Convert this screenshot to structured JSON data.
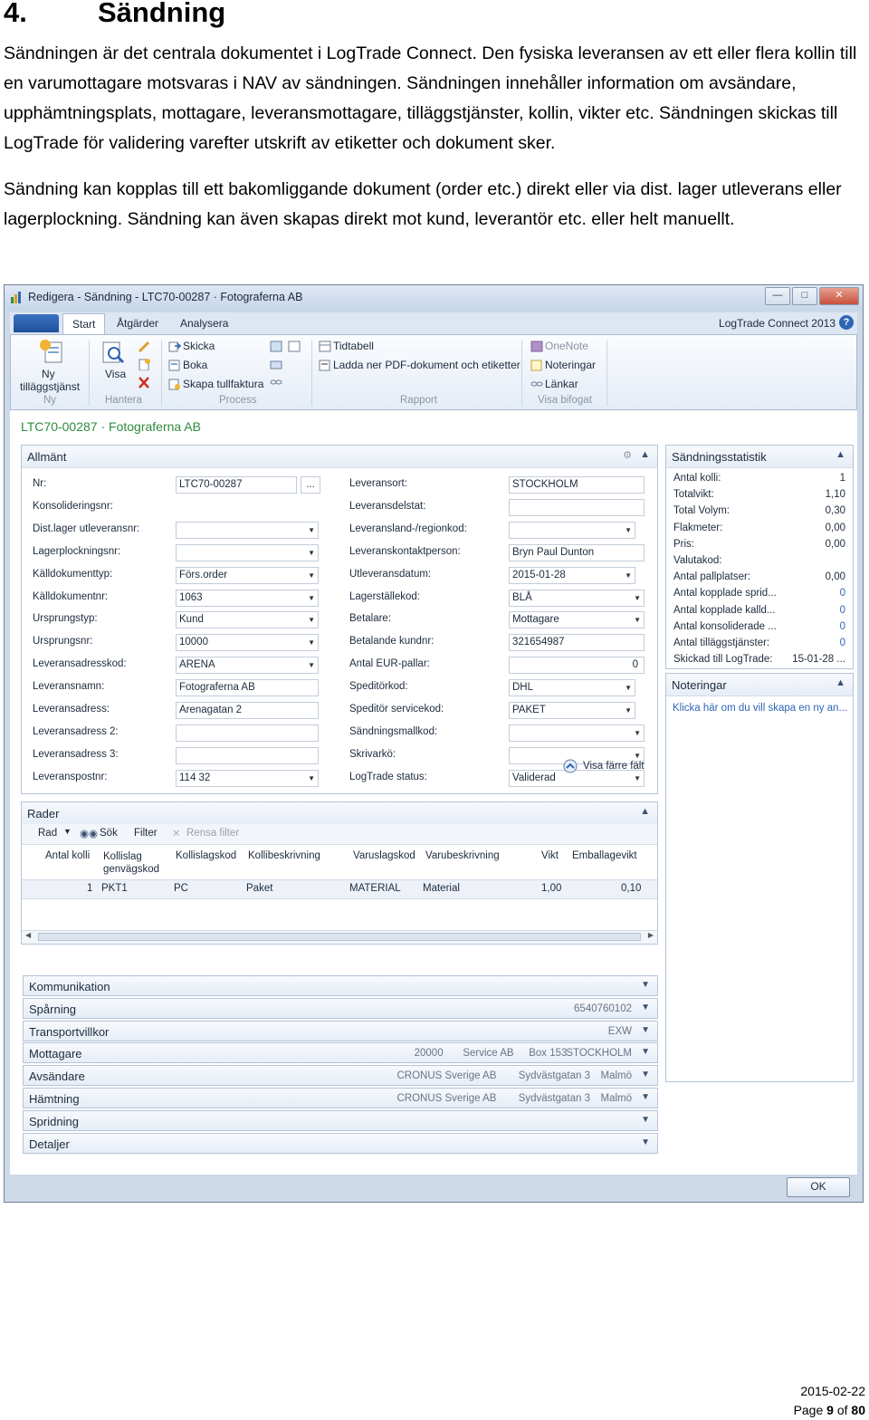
{
  "document": {
    "heading_number": "4.",
    "heading_title": "Sändning",
    "paragraph1": "Sändningen är det centrala dokumentet i LogTrade Connect. Den fysiska leveransen av ett eller flera kollin till en varumottagare motsvaras i NAV av sändningen. Sändningen innehåller information om avsändare, upphämtningsplats, mottagare, leveransmottagare, tilläggstjänster, kollin, vikter etc. Sändningen skickas till LogTrade för validering varefter utskrift av etiketter och dokument sker.",
    "paragraph2": "Sändning kan kopplas till ett bakomliggande dokument (order etc.) direkt eller via dist. lager utleverans eller lagerplockning. Sändning kan även skapas direkt mot kund, leverantör etc. eller helt manuellt.",
    "footer_date": "2015-02-22",
    "footer_page_prefix": "Page ",
    "footer_page_current": "9",
    "footer_page_mid": " of ",
    "footer_page_total": "80"
  },
  "window": {
    "title": "Redigera - Sändning - LTC70-00287 · Fotograferna AB",
    "brand": "LogTrade Connect 2013",
    "tabs": [
      "Start",
      "Åtgärder",
      "Analysera"
    ],
    "ribbon": {
      "ny_label": "Ny tilläggstjänst",
      "ny_line1": "Ny",
      "ny_line2": "tilläggstjänst",
      "visa": "Visa",
      "skicka": "Skicka",
      "boka": "Boka",
      "skapa_tullfaktura": "Skapa tullfaktura",
      "tidtabell": "Tidtabell",
      "ladda_ner": "Ladda ner PDF-dokument och etiketter",
      "onenote": "OneNote",
      "noteringar": "Noteringar",
      "lankar": "Länkar",
      "groups": {
        "ny": "Ny",
        "hantera": "Hantera",
        "process": "Process",
        "rapport": "Rapport",
        "visa_bifogat": "Visa bifogat"
      }
    },
    "page_title": "LTC70-00287 · Fotograferna AB",
    "allmant": {
      "title": "Allmänt",
      "left_fields": [
        {
          "label": "Nr:",
          "value": "LTC70-00287",
          "type": "text"
        },
        {
          "label": "Konsolideringsnr:",
          "value": "",
          "type": "none"
        },
        {
          "label": "Dist.lager utleveransnr:",
          "value": "",
          "type": "dropdown"
        },
        {
          "label": "Lagerplockningsnr:",
          "value": "",
          "type": "dropdown"
        },
        {
          "label": "Källdokumenttyp:",
          "value": "Förs.order",
          "type": "dropdown"
        },
        {
          "label": "Källdokumentnr:",
          "value": "1063",
          "type": "dropdown"
        },
        {
          "label": "Ursprungstyp:",
          "value": "Kund",
          "type": "dropdown"
        },
        {
          "label": "Ursprungsnr:",
          "value": "10000",
          "type": "dropdown"
        },
        {
          "label": "Leveransadresskod:",
          "value": "ARENA",
          "type": "dropdown"
        },
        {
          "label": "Leveransnamn:",
          "value": "Fotograferna AB",
          "type": "text"
        },
        {
          "label": "Leveransadress:",
          "value": "Arenagatan 2",
          "type": "text"
        },
        {
          "label": "Leveransadress 2:",
          "value": "",
          "type": "text"
        },
        {
          "label": "Leveransadress 3:",
          "value": "",
          "type": "text"
        },
        {
          "label": "Leveranspostnr:",
          "value": "114 32",
          "type": "dropdown"
        }
      ],
      "right_fields": [
        {
          "label": "Leveransort:",
          "value": "STOCKHOLM",
          "type": "text"
        },
        {
          "label": "Leveransdelstat:",
          "value": "",
          "type": "text"
        },
        {
          "label": "Leveransland-/regionkod:",
          "value": "",
          "type": "dropdown-short"
        },
        {
          "label": "Leveranskontaktperson:",
          "value": "Bryn Paul Dunton",
          "type": "text"
        },
        {
          "label": "Utleveransdatum:",
          "value": "2015-01-28",
          "type": "dropdown-short"
        },
        {
          "label": "Lagerställekod:",
          "value": "BLÅ",
          "type": "dropdown"
        },
        {
          "label": "Betalare:",
          "value": "Mottagare",
          "type": "dropdown"
        },
        {
          "label": "Betalande kundnr:",
          "value": "321654987",
          "type": "text"
        },
        {
          "label": "Antal EUR-pallar:",
          "value": "0",
          "type": "num"
        },
        {
          "label": "Speditörkod:",
          "value": "DHL",
          "type": "dropdown-short"
        },
        {
          "label": "Speditör servicekod:",
          "value": "PAKET",
          "type": "dropdown-short"
        },
        {
          "label": "Sändningsmallkod:",
          "value": "",
          "type": "dropdown"
        },
        {
          "label": "Skrivarkö:",
          "value": "",
          "type": "dropdown"
        },
        {
          "label": "LogTrade status:",
          "value": "Validerad",
          "type": "dropdown"
        }
      ],
      "fewer_fields": "Visa färre fält"
    },
    "stats": {
      "title": "Sändningsstatistik",
      "rows": [
        {
          "label": "Antal kolli:",
          "value": "1",
          "blue": false
        },
        {
          "label": "Totalvikt:",
          "value": "1,10",
          "blue": false
        },
        {
          "label": "Total Volym:",
          "value": "0,30",
          "blue": false
        },
        {
          "label": "Flakmeter:",
          "value": "0,00",
          "blue": false
        },
        {
          "label": "Pris:",
          "value": "0,00",
          "blue": false
        },
        {
          "label": "Valutakod:",
          "value": "",
          "blue": false
        },
        {
          "label": "Antal pallplatser:",
          "value": "0,00",
          "blue": false
        },
        {
          "label": "Antal kopplade sprid...",
          "value": "0",
          "blue": true
        },
        {
          "label": "Antal kopplade kalld...",
          "value": "0",
          "blue": true
        },
        {
          "label": "Antal konsoliderade ...",
          "value": "0",
          "blue": true
        },
        {
          "label": "Antal tilläggstjänster:",
          "value": "0",
          "blue": true
        },
        {
          "label": "Skickad till LogTrade:",
          "value": "15-01-28 ...",
          "blue": false
        }
      ]
    },
    "notes": {
      "title": "Noteringar",
      "link": "Klicka här om du vill skapa en ny an..."
    },
    "rader": {
      "title": "Rader",
      "toolbar": {
        "rad": "Rad",
        "sok": "Sök",
        "filter": "Filter",
        "rensa": "Rensa filter"
      },
      "columns": [
        "Antal kolli",
        "Kollislag genvägskod",
        "Kollislagskod",
        "Kollibeskrivning",
        "Varuslagskod",
        "Varubeskrivning",
        "Vikt",
        "Emballagevikt"
      ],
      "col_kollislag_1": "Kollislag",
      "col_kollislag_2": "genvägskod",
      "rows": [
        {
          "antal": "1",
          "genvag": "PKT1",
          "kollislag": "PC",
          "kollibeskr": "Paket",
          "varuslag": "MATERIAL",
          "varubeskr": "Material",
          "vikt": "1,00",
          "emballage": "0,10"
        }
      ]
    },
    "fasttabs": [
      {
        "title": "Kommunikation",
        "values": []
      },
      {
        "title": "Spårning",
        "values": [
          "6540760102"
        ]
      },
      {
        "title": "Transportvillkor",
        "values": [
          "EXW"
        ]
      },
      {
        "title": "Mottagare",
        "values": [
          "20000",
          "Service AB",
          "Box 153",
          "STOCKHOLM"
        ]
      },
      {
        "title": "Avsändare",
        "values": [
          "CRONUS Sverige AB",
          "Sydvästgatan 3",
          "Malmö"
        ]
      },
      {
        "title": "Hämtning",
        "values": [
          "CRONUS Sverige AB",
          "Sydvästgatan 3",
          "Malmö"
        ]
      },
      {
        "title": "Spridning",
        "values": []
      },
      {
        "title": "Detaljer",
        "values": []
      }
    ],
    "ok": "OK"
  },
  "colors": {
    "page_title": "#2e8b3c",
    "link": "#2f65b5",
    "window_bg": "#cdd9e8"
  }
}
